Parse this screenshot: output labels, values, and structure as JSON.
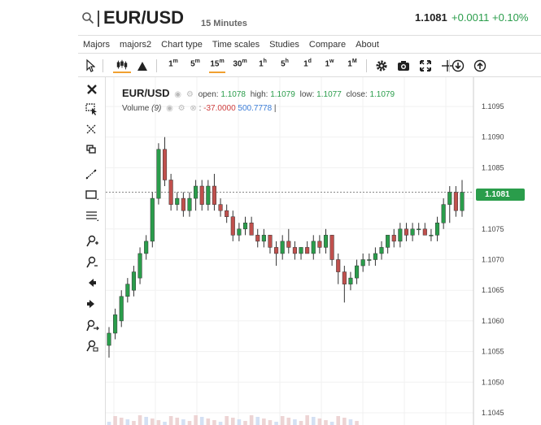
{
  "header": {
    "symbol": "EUR/USD",
    "timeframe": "15 Minutes",
    "last_price": "1.1081",
    "change": "+0.0011",
    "change_pct": "+0.10%"
  },
  "menu": [
    "Majors",
    "majors2",
    "Chart type",
    "Time scales",
    "Studies",
    "Compare",
    "About"
  ],
  "toolbar": {
    "intervals": [
      {
        "num": "1",
        "unit": "m"
      },
      {
        "num": "5",
        "unit": "m"
      },
      {
        "num": "15",
        "unit": "m"
      },
      {
        "num": "30",
        "unit": "m"
      },
      {
        "num": "1",
        "unit": "h"
      },
      {
        "num": "5",
        "unit": "h"
      },
      {
        "num": "1",
        "unit": "d"
      },
      {
        "num": "1",
        "unit": "w"
      },
      {
        "num": "1",
        "unit": "M"
      }
    ],
    "active_interval": "15m"
  },
  "legend": {
    "symbol": "EUR/USD",
    "open_label": "open:",
    "open": "1.1078",
    "high_label": "high:",
    "high": "1.1079",
    "low_label": "low:",
    "low": "1.1077",
    "close_label": "close:",
    "close": "1.1079",
    "volume_label": "Volume",
    "volume_period": "(9)",
    "volume_neg": "-37.0000",
    "volume_pos": "500.7778"
  },
  "price_tag": "1.1081",
  "colors": {
    "up": "#2a9d4b",
    "down": "#c0504d",
    "accent": "#f0a030"
  },
  "chart_data": {
    "type": "candlestick",
    "y_ticks": [
      "1.1095",
      "1.1090",
      "1.1085",
      "1.1080",
      "1.1075",
      "1.1070",
      "1.1065",
      "1.1060",
      "1.1055",
      "1.1050",
      "1.1045"
    ],
    "ylim": [
      1.1043,
      1.11
    ],
    "current_price": 1.1081,
    "candles": [
      {
        "o": 1.1056,
        "h": 1.1059,
        "l": 1.1054,
        "c": 1.1058
      },
      {
        "o": 1.1058,
        "h": 1.1062,
        "l": 1.1057,
        "c": 1.1061
      },
      {
        "o": 1.106,
        "h": 1.1065,
        "l": 1.1059,
        "c": 1.1064
      },
      {
        "o": 1.1064,
        "h": 1.1067,
        "l": 1.1063,
        "c": 1.1066
      },
      {
        "o": 1.1065,
        "h": 1.1069,
        "l": 1.1064,
        "c": 1.1068
      },
      {
        "o": 1.1067,
        "h": 1.1072,
        "l": 1.1066,
        "c": 1.1071
      },
      {
        "o": 1.1071,
        "h": 1.1074,
        "l": 1.107,
        "c": 1.1073
      },
      {
        "o": 1.1073,
        "h": 1.1081,
        "l": 1.1072,
        "c": 1.108
      },
      {
        "o": 1.108,
        "h": 1.1089,
        "l": 1.1079,
        "c": 1.1088
      },
      {
        "o": 1.1088,
        "h": 1.109,
        "l": 1.1082,
        "c": 1.1083
      },
      {
        "o": 1.1083,
        "h": 1.1084,
        "l": 1.1078,
        "c": 1.1079
      },
      {
        "o": 1.1079,
        "h": 1.1081,
        "l": 1.1078,
        "c": 1.108
      },
      {
        "o": 1.108,
        "h": 1.1081,
        "l": 1.1077,
        "c": 1.1078
      },
      {
        "o": 1.1078,
        "h": 1.1081,
        "l": 1.1077,
        "c": 1.108
      },
      {
        "o": 1.108,
        "h": 1.1083,
        "l": 1.1078,
        "c": 1.1082
      },
      {
        "o": 1.1082,
        "h": 1.1083,
        "l": 1.1078,
        "c": 1.1079
      },
      {
        "o": 1.1079,
        "h": 1.1083,
        "l": 1.1078,
        "c": 1.1082
      },
      {
        "o": 1.1082,
        "h": 1.1084,
        "l": 1.1078,
        "c": 1.1079
      },
      {
        "o": 1.1079,
        "h": 1.108,
        "l": 1.1077,
        "c": 1.1078
      },
      {
        "o": 1.1078,
        "h": 1.1079,
        "l": 1.1076,
        "c": 1.1077
      },
      {
        "o": 1.1077,
        "h": 1.1078,
        "l": 1.1073,
        "c": 1.1074
      },
      {
        "o": 1.1074,
        "h": 1.1076,
        "l": 1.1073,
        "c": 1.1075
      },
      {
        "o": 1.1075,
        "h": 1.1077,
        "l": 1.1074,
        "c": 1.1076
      },
      {
        "o": 1.1076,
        "h": 1.1077,
        "l": 1.1074,
        "c": 1.1074
      },
      {
        "o": 1.1074,
        "h": 1.1075,
        "l": 1.1072,
        "c": 1.1073
      },
      {
        "o": 1.1073,
        "h": 1.1075,
        "l": 1.1072,
        "c": 1.1074
      },
      {
        "o": 1.1074,
        "h": 1.1074,
        "l": 1.1071,
        "c": 1.1072
      },
      {
        "o": 1.1072,
        "h": 1.1073,
        "l": 1.1069,
        "c": 1.1071
      },
      {
        "o": 1.1071,
        "h": 1.1074,
        "l": 1.107,
        "c": 1.1073
      },
      {
        "o": 1.1073,
        "h": 1.1075,
        "l": 1.1071,
        "c": 1.1072
      },
      {
        "o": 1.1072,
        "h": 1.1073,
        "l": 1.107,
        "c": 1.1071
      },
      {
        "o": 1.1071,
        "h": 1.1072,
        "l": 1.107,
        "c": 1.1072
      },
      {
        "o": 1.1072,
        "h": 1.1073,
        "l": 1.1071,
        "c": 1.1071
      },
      {
        "o": 1.1071,
        "h": 1.1074,
        "l": 1.107,
        "c": 1.1073
      },
      {
        "o": 1.1073,
        "h": 1.1074,
        "l": 1.1071,
        "c": 1.1072
      },
      {
        "o": 1.1072,
        "h": 1.1075,
        "l": 1.1071,
        "c": 1.1074
      },
      {
        "o": 1.1074,
        "h": 1.1074,
        "l": 1.1069,
        "c": 1.107
      },
      {
        "o": 1.107,
        "h": 1.1071,
        "l": 1.1066,
        "c": 1.1068
      },
      {
        "o": 1.1068,
        "h": 1.1069,
        "l": 1.1063,
        "c": 1.1066
      },
      {
        "o": 1.1066,
        "h": 1.1068,
        "l": 1.1065,
        "c": 1.1067
      },
      {
        "o": 1.1067,
        "h": 1.107,
        "l": 1.1066,
        "c": 1.1069
      },
      {
        "o": 1.1069,
        "h": 1.1071,
        "l": 1.1068,
        "c": 1.107
      },
      {
        "o": 1.107,
        "h": 1.1071,
        "l": 1.1069,
        "c": 1.107
      },
      {
        "o": 1.107,
        "h": 1.1072,
        "l": 1.1069,
        "c": 1.1071
      },
      {
        "o": 1.1071,
        "h": 1.1073,
        "l": 1.107,
        "c": 1.1072
      },
      {
        "o": 1.1072,
        "h": 1.1074,
        "l": 1.1071,
        "c": 1.1074
      },
      {
        "o": 1.1074,
        "h": 1.1075,
        "l": 1.1072,
        "c": 1.1073
      },
      {
        "o": 1.1073,
        "h": 1.1076,
        "l": 1.1072,
        "c": 1.1075
      },
      {
        "o": 1.1075,
        "h": 1.1076,
        "l": 1.1073,
        "c": 1.1074
      },
      {
        "o": 1.1074,
        "h": 1.1076,
        "l": 1.1073,
        "c": 1.1075
      },
      {
        "o": 1.1075,
        "h": 1.1076,
        "l": 1.1074,
        "c": 1.1075
      },
      {
        "o": 1.1075,
        "h": 1.1076,
        "l": 1.1074,
        "c": 1.1074
      },
      {
        "o": 1.1074,
        "h": 1.1075,
        "l": 1.1073,
        "c": 1.1074
      },
      {
        "o": 1.1074,
        "h": 1.1077,
        "l": 1.1073,
        "c": 1.1076
      },
      {
        "o": 1.1076,
        "h": 1.108,
        "l": 1.1075,
        "c": 1.1079
      },
      {
        "o": 1.1079,
        "h": 1.1082,
        "l": 1.1076,
        "c": 1.1081
      },
      {
        "o": 1.1081,
        "h": 1.1082,
        "l": 1.1077,
        "c": 1.1078
      },
      {
        "o": 1.1078,
        "h": 1.1083,
        "l": 1.1077,
        "c": 1.1081
      }
    ]
  }
}
